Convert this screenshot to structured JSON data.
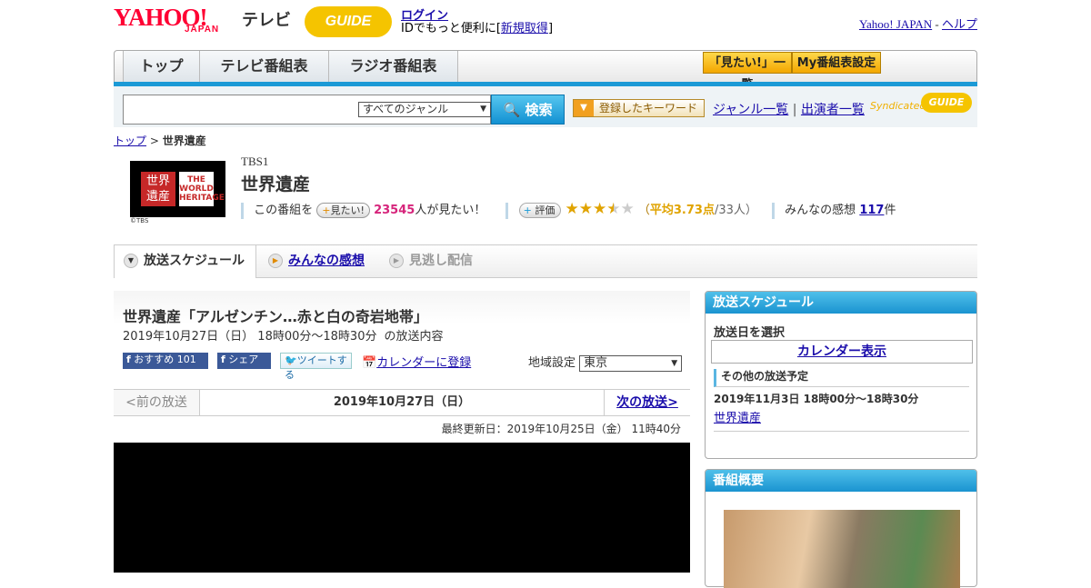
{
  "header": {
    "yahoo_logo": "YAHOO!",
    "japan_logo": "JAPAN",
    "tv_label": "テレビ",
    "gguide_logo": "GUIDE",
    "login": "ログイン",
    "id_prefix": "IDでもっと便利に[",
    "register": "新規取得",
    "id_suffix": "]",
    "yahoo_japan_link": "Yahoo! JAPAN",
    "separator": "-",
    "help_link": "ヘルプ"
  },
  "nav": {
    "tabs": [
      "トップ",
      "テレビ番組表",
      "ラジオ番組表"
    ],
    "mitai_list": "「見たい!」一覧",
    "my_schedule": "My番組表設定"
  },
  "search": {
    "genre": "すべてのジャンル",
    "button": "検索",
    "keyword_button": "登録したキーワード",
    "genre_list": "ジャンル一覧",
    "divider": "|",
    "cast_list": "出演者一覧",
    "syndicated": "Syndicated",
    "syndicated_logo": "GUIDE"
  },
  "breadcrumb": {
    "top": "トップ",
    "sep": ">",
    "current": "世界遺産"
  },
  "program": {
    "thumb_left": "世界遺産",
    "thumb_right": "THE WORLD HERITAGE",
    "copyright": "©TBS",
    "channel": "TBS1",
    "title": "世界遺産",
    "this_program": "この番組を",
    "mitai_button": "見たい!",
    "mitai_count": "23545",
    "mitai_suffix": "人が見たい！",
    "rating_button": "評価",
    "rating": 3.73,
    "rating_text_open": "（",
    "rating_avg": "平均3.73点",
    "rating_people": "/33人）",
    "impressions_label": "みんなの感想",
    "impressions_count": "117",
    "impressions_suffix": "件"
  },
  "tabs": {
    "schedule": "放送スケジュール",
    "impressions": "みんなの感想",
    "missed": "見逃し配信"
  },
  "episode": {
    "title": "世界遺産「アルゼンチン…赤と白の奇岩地帯」",
    "datetime": "2019年10月27日（日） 18時00分～18時30分",
    "content_label": "の放送内容",
    "fb_recommend": "おすすめ",
    "fb_count": "101",
    "fb_share": "シェア",
    "tweet": "ツイートする",
    "calendar": "カレンダーに登録",
    "region_label": "地域設定",
    "region": "東京"
  },
  "nav_row": {
    "prev": "<前の放送",
    "current": "2019年10月27日（日）",
    "next": "次の放送>"
  },
  "updated": "最終更新日：2019年10月25日（金） 11時40分",
  "sidebar": {
    "schedule_header": "放送スケジュール",
    "select_date": "放送日を選択",
    "calendar_button": "カレンダー表示",
    "other_schedule": "その他の放送予定",
    "other_date": "2019年11月3日 18時00分～18時30分",
    "other_link": "世界遺産",
    "overview_header": "番組概要"
  },
  "colors": {
    "yahoo_red": "#ff0033",
    "accent_blue": "#1b9ad6",
    "gguide_yellow": "#f5c400",
    "mitai_pink": "#d6247b",
    "rating_orange": "#e0a300"
  }
}
